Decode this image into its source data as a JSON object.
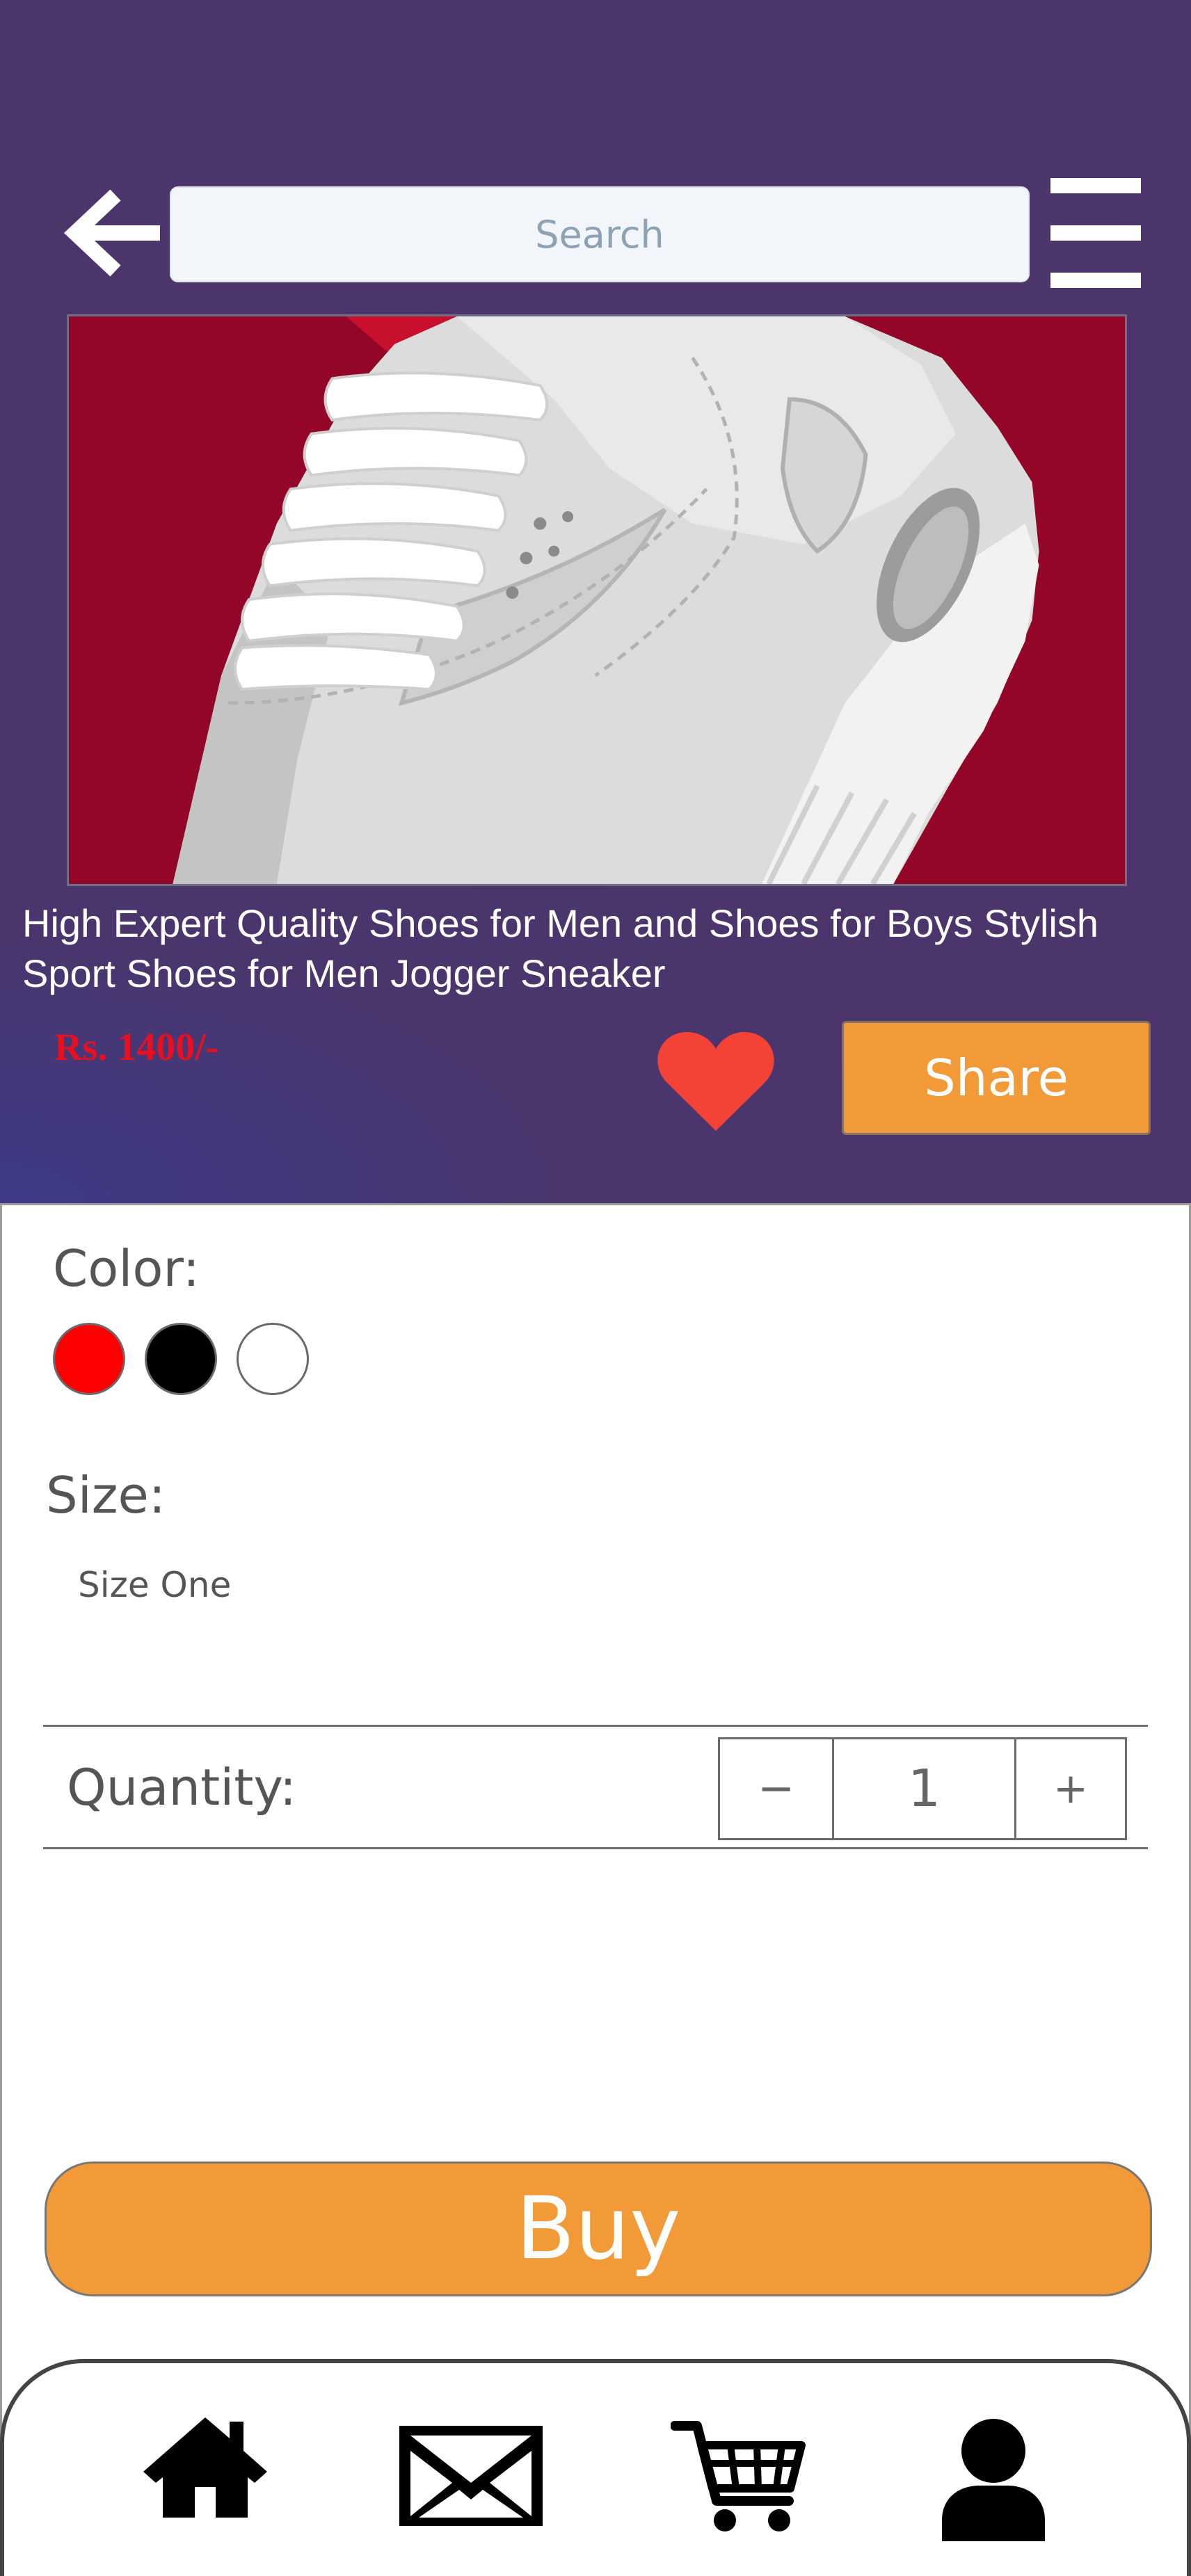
{
  "header": {
    "search": {
      "placeholder": "Search",
      "value": ""
    }
  },
  "product": {
    "title": "High Expert Quality Shoes for Men and Shoes for Boys Stylish Sport Shoes for Men Jogger Sneaker",
    "price": "Rs. 1400/-",
    "share_label": "Share"
  },
  "options": {
    "color_label": "Color:",
    "colors": [
      "#ff0000",
      "#000000",
      "#ffffff"
    ],
    "size_label": "Size:",
    "size_option": "Size One",
    "quantity_label": "Quantity:",
    "quantity_minus": "−",
    "quantity_value": "1",
    "quantity_plus": "+"
  },
  "actions": {
    "buy_label": "Buy"
  },
  "colors": {
    "header_bg": "#4b356b",
    "accent": "#f29a38",
    "price": "#e8101e",
    "heart": "#f44336"
  },
  "bottom_nav": {
    "items": [
      "home-icon",
      "mail-icon",
      "cart-icon",
      "profile-icon"
    ]
  }
}
